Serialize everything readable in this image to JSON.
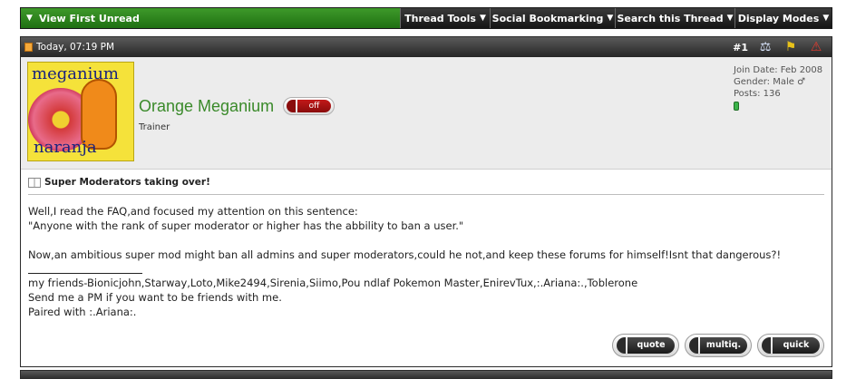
{
  "toolbar": {
    "first_unread": "View First Unread",
    "thread_tools": "Thread Tools",
    "social_bookmarking": "Social Bookmarking",
    "search_thread": "Search this Thread",
    "display_modes": "Display Modes"
  },
  "post": {
    "date": "Today, 07:19 PM",
    "number": "#1",
    "icons": [
      "scale-icon",
      "flag-icon",
      "warning-icon"
    ],
    "user": {
      "name": "Orange Meganium",
      "status": "off",
      "title": "Trainer",
      "avatar_text_top": "meganium",
      "avatar_text_bottom": "naranja",
      "join_date": "Join Date: Feb 2008",
      "gender": "Gender: Male ♂",
      "posts": "Posts: 136"
    },
    "thread_title": "Super Moderators taking over!",
    "message": {
      "line1": "Well,I read the FAQ,and focused my attention on this sentence:",
      "line2": "\"Anyone with the rank of super moderator or higher has the abbility to ban a user.\"",
      "line3": "Now,an ambitious super mod might ban all admins and super moderators,could he not,and keep these forums for himself!Isnt that dangerous?!"
    },
    "signature": {
      "line1": "my friends-Bionicjohn,Starway,Loto,Mike2494,Sirenia,Siimo,Pou ndlaf Pokemon Master,EnirevTux,:.Ariana:.,Toblerone",
      "line2": "Send me a PM if you want to be friends with me.",
      "line3": "Paired with :.Ariana:."
    },
    "buttons": {
      "quote": "quote",
      "multiquote": "multiq.",
      "quick": "quick"
    }
  },
  "colors": {
    "accent_green": "#2e8a1e",
    "username_green": "#3a8a2a",
    "header_dark": "#262626"
  }
}
